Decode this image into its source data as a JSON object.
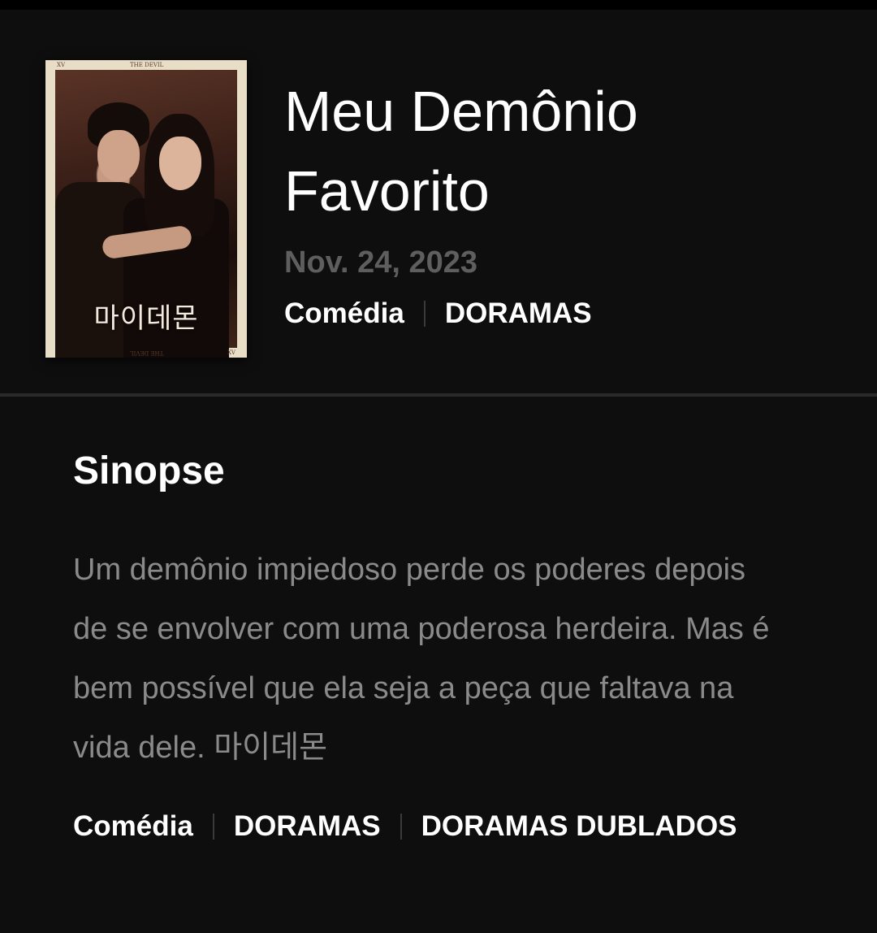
{
  "show": {
    "title": "Meu Demônio Favorito",
    "date": "Nov. 24, 2023",
    "tags": [
      "Comédia",
      "DORAMAS"
    ],
    "poster_title": "마이데몬",
    "poster_corner_tl": "XV",
    "poster_corner_tc": "THE DEVIL",
    "poster_corner_bc": "THE DEVIL",
    "poster_corner_br": "XV"
  },
  "synopsis": {
    "heading": "Sinopse",
    "text": "Um demônio impiedoso perde os poderes depois de se envolver com uma poderosa herdeira. Mas é bem possível que ela seja a peça que faltava na vida dele. 마이데몬",
    "tags": [
      "Comédia",
      "DORAMAS",
      "DORAMAS DUBLADOS"
    ]
  },
  "colors": {
    "background": "#0e0e0e",
    "divider": "#2a2a2a",
    "date": "#5e5e5e",
    "synopsis_text": "#8a8a8a"
  }
}
